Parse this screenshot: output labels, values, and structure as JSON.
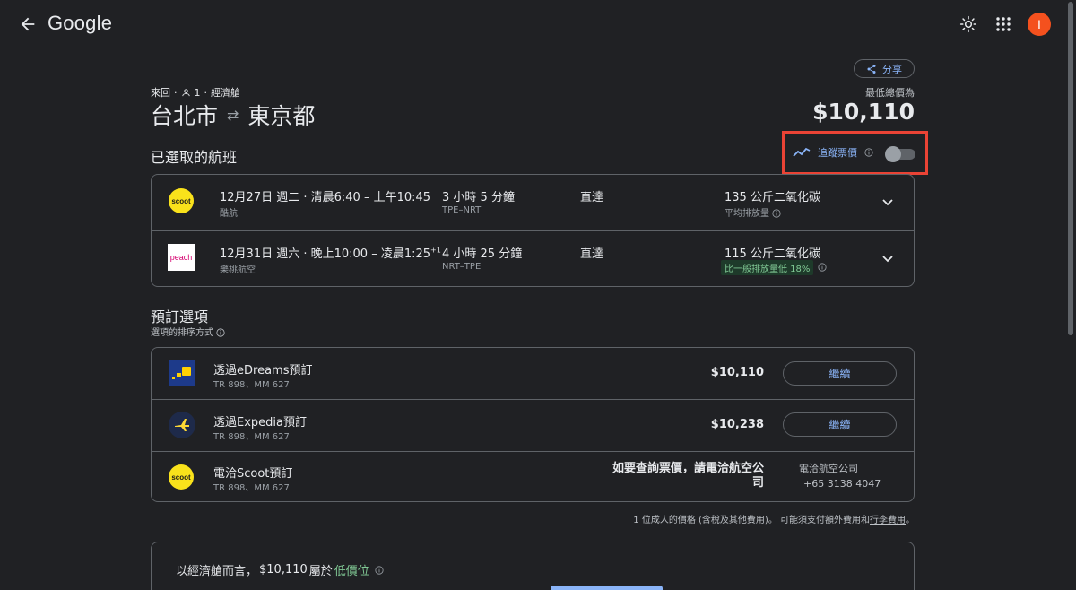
{
  "header": {
    "logo": "Google",
    "avatar_initial": "I"
  },
  "share_label": "分享",
  "trip": {
    "type": "來回",
    "passengers": "1",
    "cabin": "經濟艙",
    "origin": "台北市",
    "destination": "東京都",
    "price_caption": "最低總價為",
    "total_price": "$10,110"
  },
  "selected_section": {
    "title": "已選取的航班",
    "track_label": "追蹤票價",
    "track_on": false
  },
  "flights": [
    {
      "airline_logo_text": "scoot",
      "date_time": "12月27日 週二 · 清晨6:40 – 上午10:45",
      "airline": "酷航",
      "duration": "3 小時 5 分鐘",
      "route": "TPE–NRT",
      "stops": "直達",
      "emissions": "135 公斤二氧化碳",
      "emissions_note": "平均排放量"
    },
    {
      "airline_logo_text": "peach",
      "date_time": "12月31日 週六 · 晚上10:00 – 凌晨1:25",
      "date_time_sup": "+1",
      "airline": "樂桃航空",
      "duration": "4 小時 25 分鐘",
      "route": "NRT–TPE",
      "stops": "直達",
      "emissions": "115 公斤二氧化碳",
      "emissions_badge": "比一般排放量低 18%"
    }
  ],
  "booking": {
    "title": "預訂選項",
    "sort_label": "選項的排序方式",
    "options": [
      {
        "name": "透過eDreams預訂",
        "flights": "TR 898、MM 627",
        "price": "$10,110",
        "button": "繼續"
      },
      {
        "name": "透過Expedia預訂",
        "flights": "TR 898、MM 627",
        "price": "$10,238",
        "button": "繼續"
      },
      {
        "name": "電洽Scoot預訂",
        "flights": "TR 898、MM 627",
        "call_text": "如要查詢票價，請電洽航空公司",
        "contact_label": "電洽航空公司",
        "phone": "+65 3138 4047"
      }
    ],
    "footnote_prefix": "1 位成人的價格 (含稅及其他費用)。 可能須支付額外費用和",
    "footnote_link": "行李費用",
    "footnote_suffix": "。"
  },
  "insight": {
    "prefix": "以經濟艙而言，",
    "price": "$10,110",
    "middle": " 屬於",
    "level": "低價位"
  }
}
